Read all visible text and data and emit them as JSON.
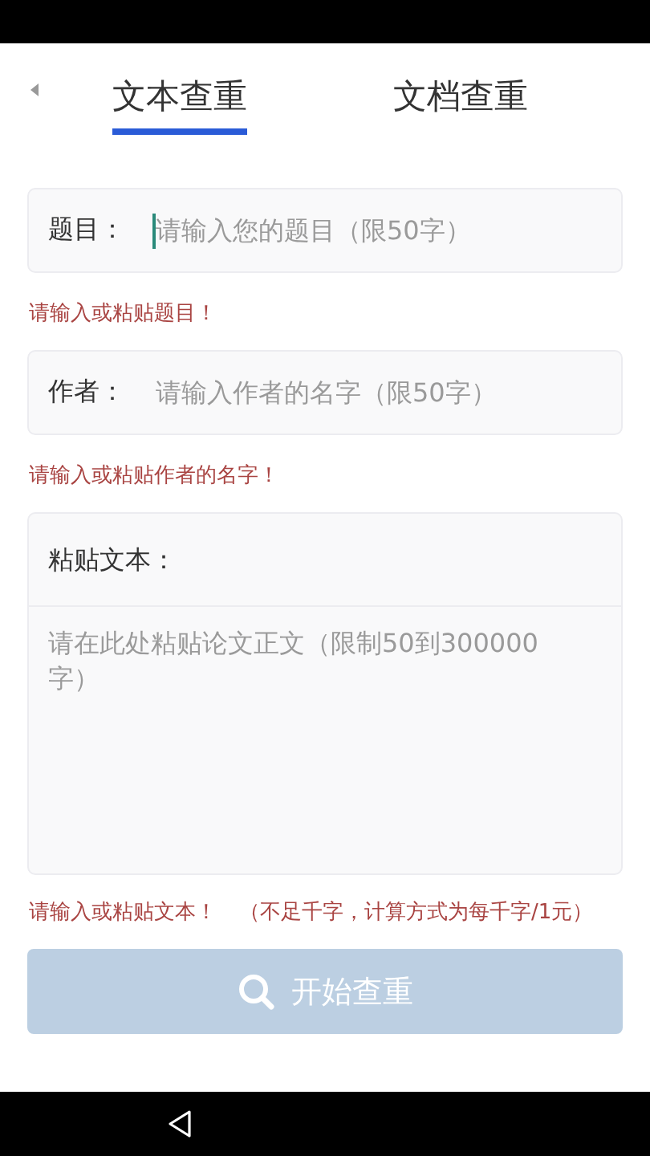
{
  "tabs": [
    {
      "label": "文本查重",
      "selected": true
    },
    {
      "label": "文档查重",
      "selected": false
    }
  ],
  "fields": [
    {
      "label": "题目：",
      "placeholder": "请输入您的题目（限50字）",
      "focused": true,
      "error": "请输入或粘贴题目！"
    },
    {
      "label": "作者：",
      "placeholder": "请输入作者的名字（限50字）",
      "focused": false,
      "error": "请输入或粘贴作者的名字！"
    }
  ],
  "text_area": {
    "label": "粘贴文本：",
    "placeholder": "请在此处粘贴论文正文（限制50到300000字）",
    "error": "请输入或粘贴文本！",
    "note": "（不足千字，计算方式为每千字/1元）"
  },
  "start_button": {
    "label": "开始查重",
    "disabled": true
  }
}
